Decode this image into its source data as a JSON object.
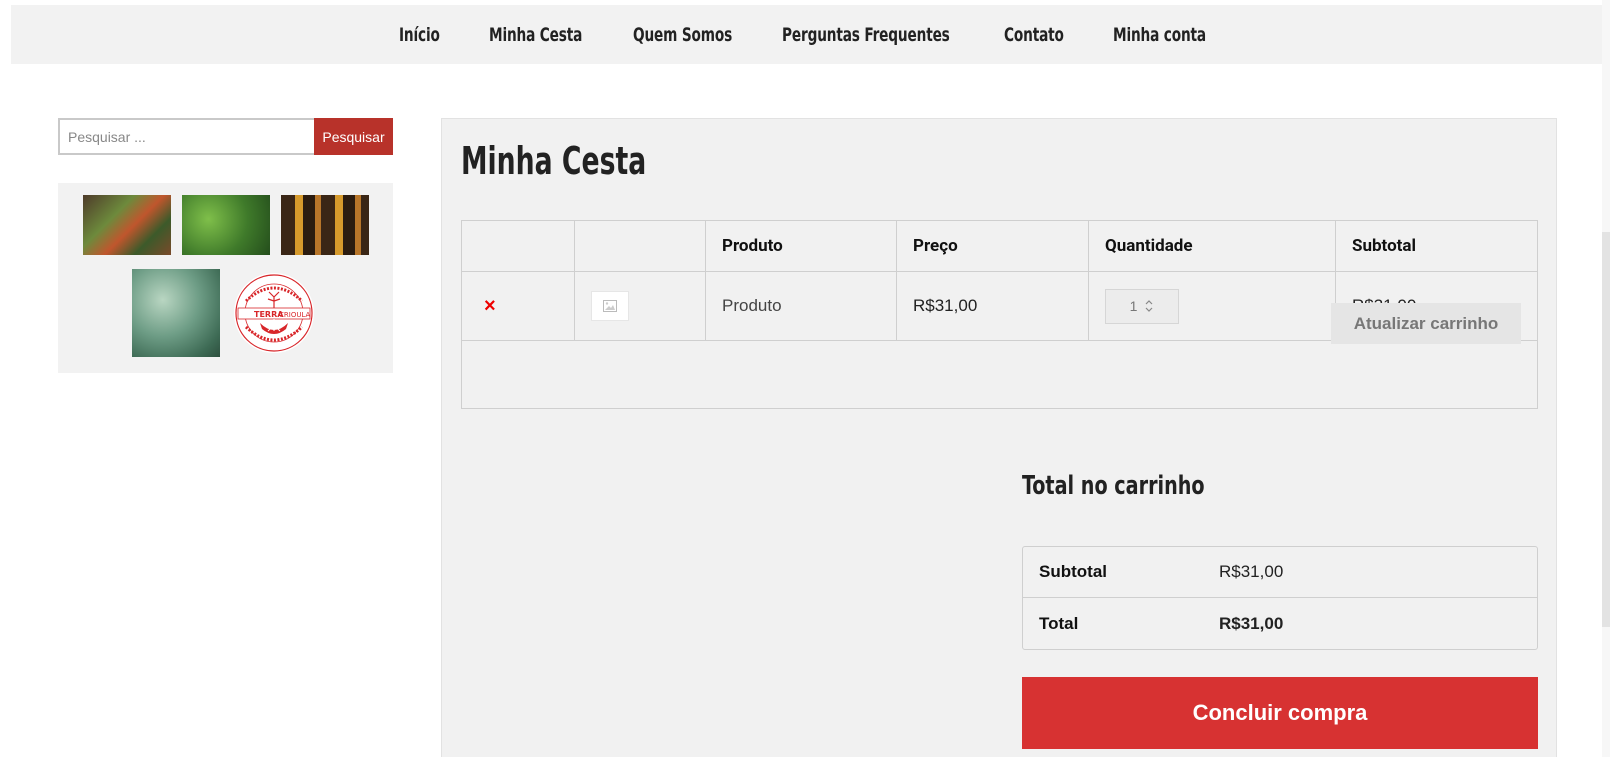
{
  "nav": {
    "items": [
      {
        "label": "Início"
      },
      {
        "label": "Minha Cesta"
      },
      {
        "label": "Quem Somos"
      },
      {
        "label": "Perguntas Frequentes"
      },
      {
        "label": "Contato"
      },
      {
        "label": "Minha conta"
      }
    ]
  },
  "sidebar": {
    "search": {
      "placeholder": "Pesquisar ...",
      "button_label": "Pesquisar"
    },
    "logo_text": {
      "ring_top": "PROJETO DA REFORMA AGRÁRIA",
      "name": "TERRA CRIOULA",
      "ring_bottom": "CULTIVANDO LUTA, RESISTÊNCIA E PRODUÇÃO"
    },
    "accent_color": "#b8322a"
  },
  "main": {
    "title": "Minha Cesta",
    "cart": {
      "headers": [
        "",
        "",
        "Produto",
        "Preço",
        "Quantidade",
        "Subtotal"
      ],
      "rows": [
        {
          "remove_symbol": "×",
          "image": "placeholder-image-icon",
          "product": "Produto",
          "price": "R$31,00",
          "quantity": "1",
          "subtotal": "R$31,00"
        }
      ],
      "update_button": "Atualizar carrinho"
    },
    "totals": {
      "title": "Total no carrinho",
      "subtotal_label": "Subtotal",
      "subtotal_value": "R$31,00",
      "total_label": "Total",
      "total_value": "R$31,00"
    },
    "checkout_button": "Concluir compra",
    "checkout_color": "#d73232"
  }
}
